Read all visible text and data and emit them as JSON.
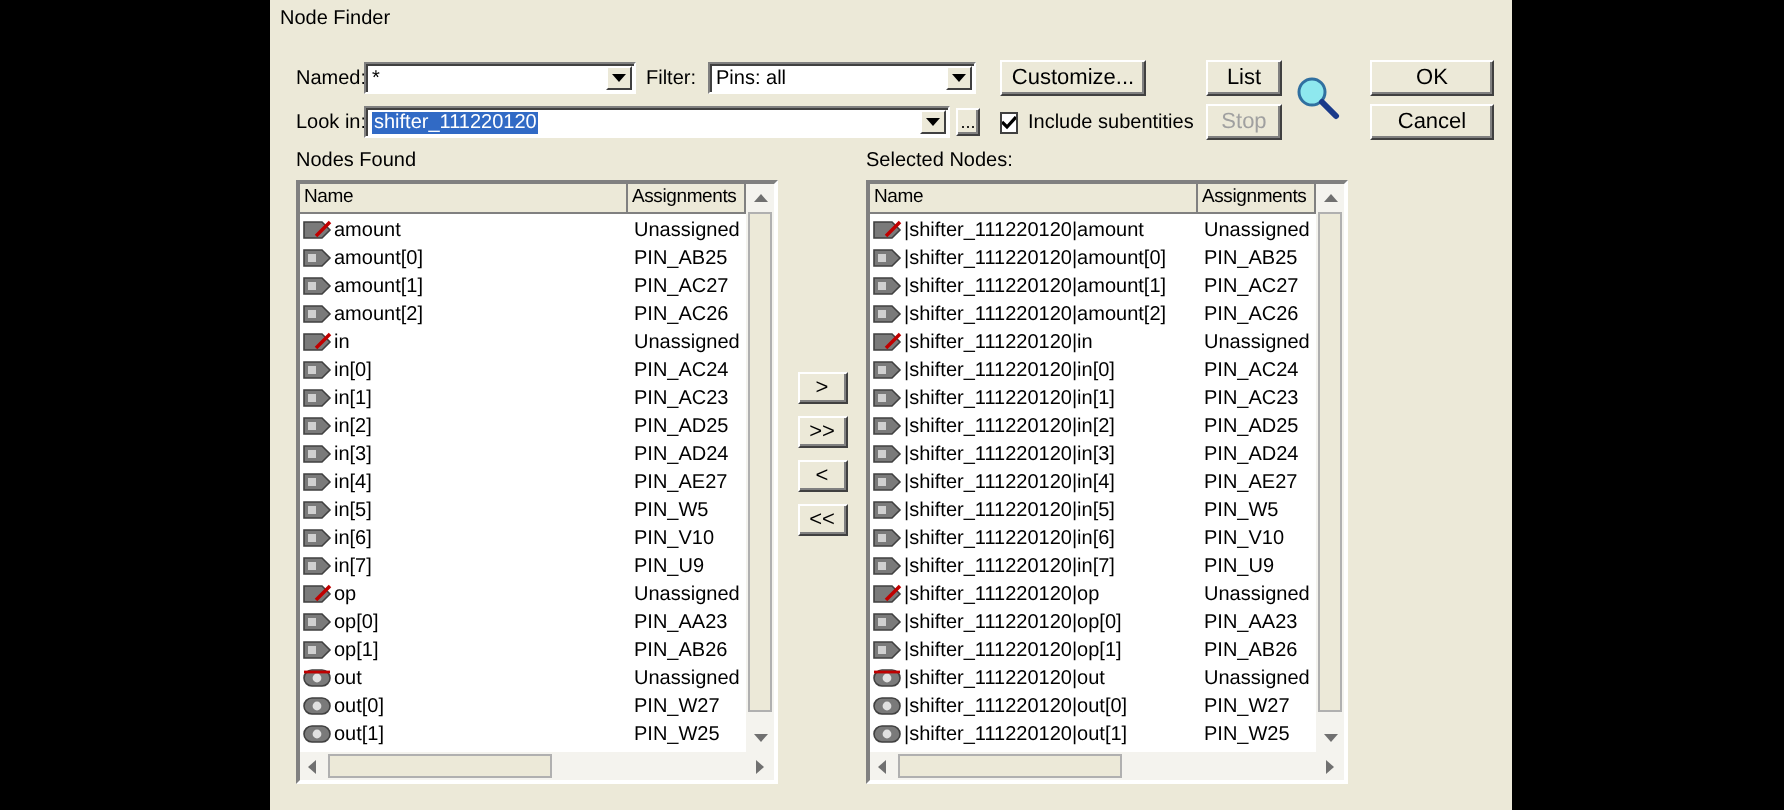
{
  "window": {
    "title": "Node Finder"
  },
  "named": {
    "label": "Named:",
    "value": "*"
  },
  "filter": {
    "label": "Filter:",
    "value": "Pins: all"
  },
  "look_in": {
    "label": "Look in:",
    "value": "shifter_111220120",
    "highlighted": true,
    "browse": "..."
  },
  "include_subentities": {
    "label": "Include subentities",
    "checked": true
  },
  "buttons": [
    {
      "label": "Customize...",
      "disabled": false
    },
    {
      "label": "List",
      "disabled": false
    },
    {
      "label": "OK",
      "disabled": false
    },
    {
      "label": "Stop",
      "disabled": true
    },
    {
      "label": "Cancel",
      "disabled": false
    }
  ],
  "nodes_found": {
    "title": "Nodes Found",
    "columns": [
      "Name",
      "Assignments"
    ],
    "rows": [
      {
        "kind": "input-bus",
        "name": "amount",
        "assignment": "Unassigned"
      },
      {
        "kind": "input",
        "name": "amount[0]",
        "assignment": "PIN_AB25"
      },
      {
        "kind": "input",
        "name": "amount[1]",
        "assignment": "PIN_AC27"
      },
      {
        "kind": "input",
        "name": "amount[2]",
        "assignment": "PIN_AC26"
      },
      {
        "kind": "input-bus",
        "name": "in",
        "assignment": "Unassigned"
      },
      {
        "kind": "input",
        "name": "in[0]",
        "assignment": "PIN_AC24"
      },
      {
        "kind": "input",
        "name": "in[1]",
        "assignment": "PIN_AC23"
      },
      {
        "kind": "input",
        "name": "in[2]",
        "assignment": "PIN_AD25"
      },
      {
        "kind": "input",
        "name": "in[3]",
        "assignment": "PIN_AD24"
      },
      {
        "kind": "input",
        "name": "in[4]",
        "assignment": "PIN_AE27"
      },
      {
        "kind": "input",
        "name": "in[5]",
        "assignment": "PIN_W5"
      },
      {
        "kind": "input",
        "name": "in[6]",
        "assignment": "PIN_V10"
      },
      {
        "kind": "input",
        "name": "in[7]",
        "assignment": "PIN_U9"
      },
      {
        "kind": "input-bus",
        "name": "op",
        "assignment": "Unassigned"
      },
      {
        "kind": "input",
        "name": "op[0]",
        "assignment": "PIN_AA23"
      },
      {
        "kind": "input",
        "name": "op[1]",
        "assignment": "PIN_AB26"
      },
      {
        "kind": "output-bus",
        "name": "out",
        "assignment": "Unassigned"
      },
      {
        "kind": "output",
        "name": "out[0]",
        "assignment": "PIN_W27"
      },
      {
        "kind": "output",
        "name": "out[1]",
        "assignment": "PIN_W25"
      }
    ]
  },
  "transfer_buttons": [
    ">",
    ">>",
    "<",
    "<<"
  ],
  "selected_nodes": {
    "title": "Selected Nodes:",
    "columns": [
      "Name",
      "Assignments"
    ],
    "rows": [
      {
        "kind": "input-bus",
        "name": "|shifter_111220120|amount",
        "assignment": "Unassigned"
      },
      {
        "kind": "input",
        "name": "|shifter_111220120|amount[0]",
        "assignment": "PIN_AB25"
      },
      {
        "kind": "input",
        "name": "|shifter_111220120|amount[1]",
        "assignment": "PIN_AC27"
      },
      {
        "kind": "input",
        "name": "|shifter_111220120|amount[2]",
        "assignment": "PIN_AC26"
      },
      {
        "kind": "input-bus",
        "name": "|shifter_111220120|in",
        "assignment": "Unassigned"
      },
      {
        "kind": "input",
        "name": "|shifter_111220120|in[0]",
        "assignment": "PIN_AC24"
      },
      {
        "kind": "input",
        "name": "|shifter_111220120|in[1]",
        "assignment": "PIN_AC23"
      },
      {
        "kind": "input",
        "name": "|shifter_111220120|in[2]",
        "assignment": "PIN_AD25"
      },
      {
        "kind": "input",
        "name": "|shifter_111220120|in[3]",
        "assignment": "PIN_AD24"
      },
      {
        "kind": "input",
        "name": "|shifter_111220120|in[4]",
        "assignment": "PIN_AE27"
      },
      {
        "kind": "input",
        "name": "|shifter_111220120|in[5]",
        "assignment": "PIN_W5"
      },
      {
        "kind": "input",
        "name": "|shifter_111220120|in[6]",
        "assignment": "PIN_V10"
      },
      {
        "kind": "input",
        "name": "|shifter_111220120|in[7]",
        "assignment": "PIN_U9"
      },
      {
        "kind": "input-bus",
        "name": "|shifter_111220120|op",
        "assignment": "Unassigned"
      },
      {
        "kind": "input",
        "name": "|shifter_111220120|op[0]",
        "assignment": "PIN_AA23"
      },
      {
        "kind": "input",
        "name": "|shifter_111220120|op[1]",
        "assignment": "PIN_AB26"
      },
      {
        "kind": "output-bus",
        "name": "|shifter_111220120|out",
        "assignment": "Unassigned"
      },
      {
        "kind": "output",
        "name": "|shifter_111220120|out[0]",
        "assignment": "PIN_W27"
      },
      {
        "kind": "output",
        "name": "|shifter_111220120|out[1]",
        "assignment": "PIN_W25"
      }
    ]
  }
}
